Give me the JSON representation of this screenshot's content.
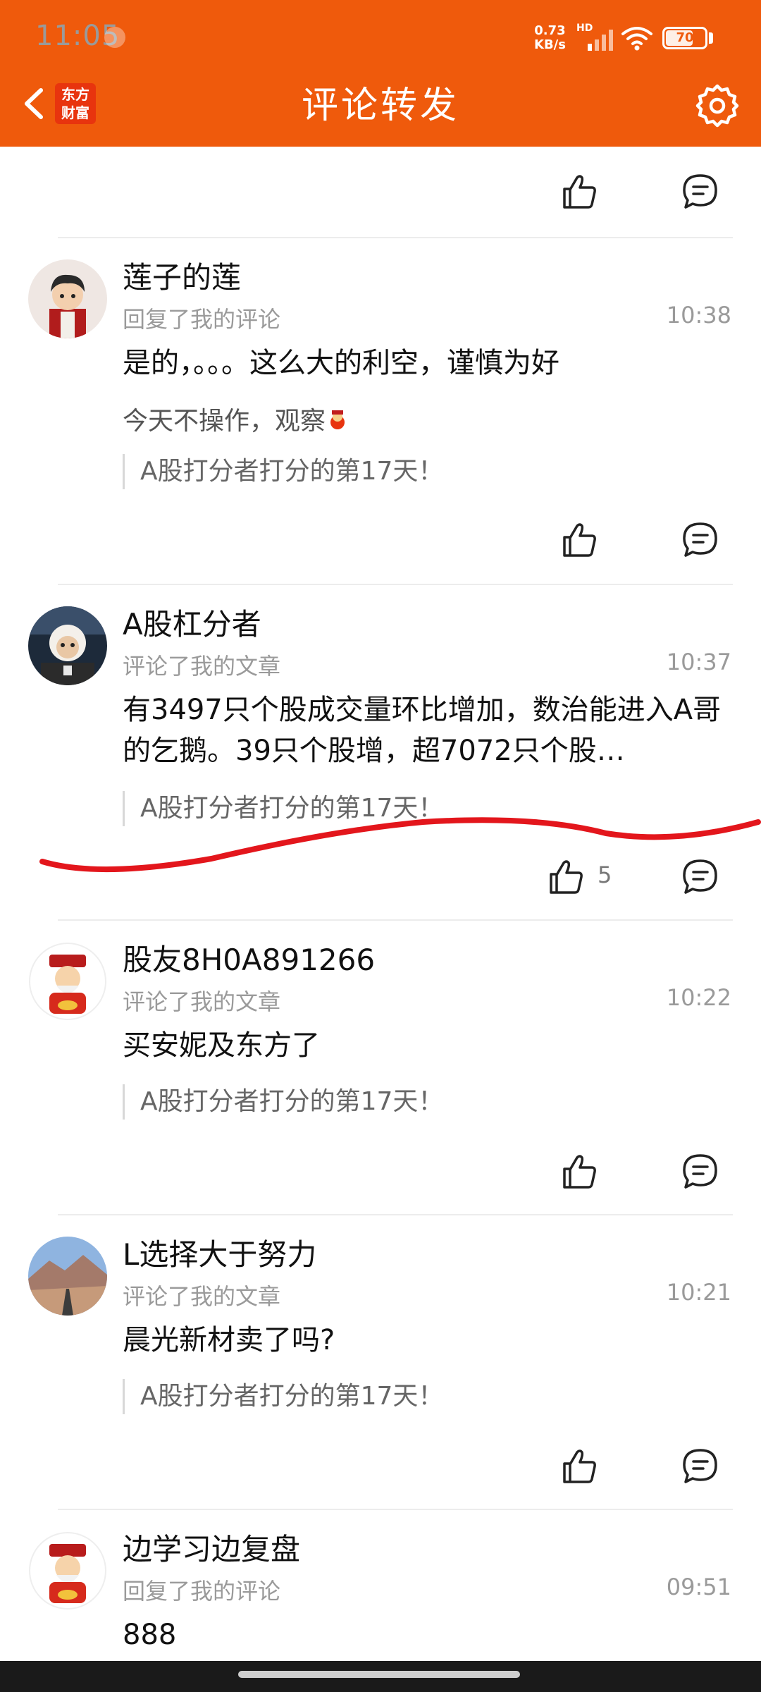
{
  "status_bar": {
    "time": "11:05",
    "net_speed_value": "0.73",
    "net_speed_unit": "KB/s",
    "network_badge": "HD",
    "battery": "70"
  },
  "header": {
    "logo_line1": "东方",
    "logo_line2": "财富",
    "title": "评论转发"
  },
  "comments": [
    {
      "name": "莲子的莲",
      "action": "回复了我的评论",
      "time": "10:38",
      "content": "是的，。。。这么大的利空，谨慎为好",
      "extra": "今天不操作，观察",
      "quote": "A股打分者打分的第17天！"
    },
    {
      "name": "A股杠分者",
      "action": "评论了我的文章",
      "time": "10:37",
      "content": "有3497只个股成交量环比增加，数治能进入A哥的乞鹅。39只个股增，超7072只个股…",
      "quote": "A股打分者打分的第17天！",
      "likes": "5"
    },
    {
      "name": "股友8H0A891266",
      "action": "评论了我的文章",
      "time": "10:22",
      "content": "买安妮及东方了",
      "quote": "A股打分者打分的第17天！"
    },
    {
      "name": "L选择大于努力",
      "action": "评论了我的文章",
      "time": "10:21",
      "content": "晨光新材卖了吗?",
      "quote": "A股打分者打分的第17天！"
    },
    {
      "name": "边学习边复盘",
      "action": "回复了我的评论",
      "time": "09:51",
      "content": "888"
    }
  ],
  "colors": {
    "brand": "#ef5a0c",
    "annotation": "#e3161c"
  }
}
